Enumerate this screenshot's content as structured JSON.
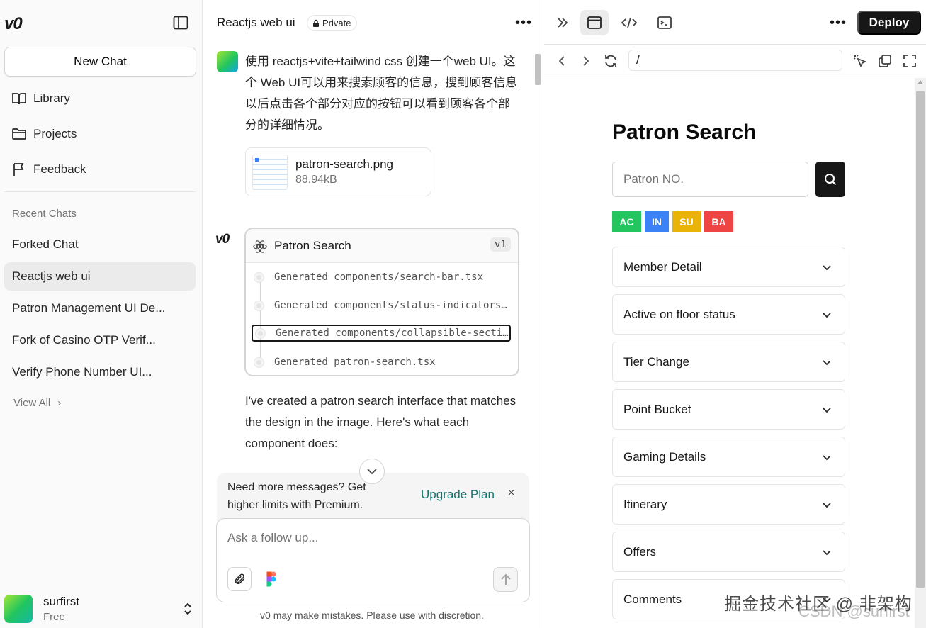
{
  "sidebar": {
    "logo": "v0",
    "new_chat": "New Chat",
    "nav": [
      {
        "label": "Library",
        "icon": "book-icon"
      },
      {
        "label": "Projects",
        "icon": "folder-icon"
      },
      {
        "label": "Feedback",
        "icon": "flag-icon"
      }
    ],
    "recent_label": "Recent Chats",
    "recent": [
      {
        "label": "Forked Chat",
        "active": false
      },
      {
        "label": "Reactjs web ui",
        "active": true
      },
      {
        "label": "Patron Management UI De...",
        "active": false
      },
      {
        "label": "Fork of Casino OTP Verif...",
        "active": false
      },
      {
        "label": "Verify Phone Number UI...",
        "active": false
      }
    ],
    "view_all": "View All",
    "user": {
      "name": "surfirst",
      "plan": "Free"
    }
  },
  "chat": {
    "title": "Reactjs web ui",
    "visibility": "Private",
    "user_message": "使用 reactjs+vite+tailwind css 创建一个web UI。这个 Web UI可以用来搜素顾客的信息，搜到顾客信息以后点击各个部分对应的按钮可以看到顾客各个部分的详细情况。",
    "attachment": {
      "name": "patron-search.png",
      "size": "88.94kB"
    },
    "generation": {
      "title": "Patron Search",
      "version": "v1",
      "steps": [
        "Generated components/search-bar.tsx",
        "Generated components/status-indicators.tsx",
        "Generated components/collapsible-section.tsx",
        "Generated patron-search.tsx"
      ]
    },
    "assistant_text": "I've created a patron search interface that matches the design in the image. Here's what each component does:",
    "upgrade": {
      "text": "Need more messages? Get higher limits with Premium.",
      "link": "Upgrade Plan",
      "close": "×"
    },
    "composer_placeholder": "Ask a follow up...",
    "disclaimer": "v0 may make mistakes. Please use with discretion."
  },
  "preview": {
    "deploy": "Deploy",
    "url": "/",
    "app": {
      "title": "Patron Search",
      "input_placeholder": "Patron NO.",
      "status_tags": [
        {
          "label": "AC",
          "color": "#22c55e"
        },
        {
          "label": "IN",
          "color": "#3b82f6"
        },
        {
          "label": "SU",
          "color": "#eab308"
        },
        {
          "label": "BA",
          "color": "#ef4444"
        }
      ],
      "sections": [
        "Member Detail",
        "Active on floor status",
        "Tier Change",
        "Point Bucket",
        "Gaming Details",
        "Itinerary",
        "Offers",
        "Comments"
      ]
    }
  },
  "watermark": {
    "cn": "掘金技术社区 @ 非架构",
    "en": "CSDN @surfirst"
  }
}
